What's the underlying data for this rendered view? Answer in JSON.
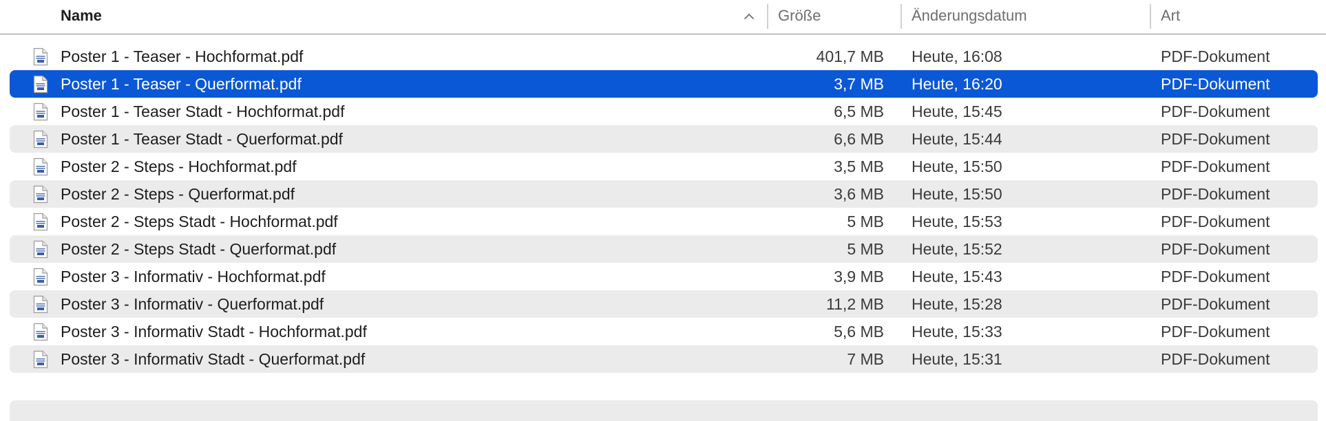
{
  "header": {
    "name": "Name",
    "size": "Größe",
    "date": "Änderungsdatum",
    "kind": "Art",
    "sort_icon": "chevron-up-icon"
  },
  "files": [
    {
      "name": "Poster 1 - Teaser - Hochformat.pdf",
      "size": "401,7 MB",
      "date": "Heute, 16:08",
      "kind": "PDF-Dokument",
      "selected": false
    },
    {
      "name": "Poster 1 - Teaser - Querformat.pdf",
      "size": "3,7 MB",
      "date": "Heute, 16:20",
      "kind": "PDF-Dokument",
      "selected": true
    },
    {
      "name": "Poster 1 - Teaser Stadt - Hochformat.pdf",
      "size": "6,5 MB",
      "date": "Heute, 15:45",
      "kind": "PDF-Dokument",
      "selected": false
    },
    {
      "name": "Poster 1 - Teaser Stadt - Querformat.pdf",
      "size": "6,6 MB",
      "date": "Heute, 15:44",
      "kind": "PDF-Dokument",
      "selected": false
    },
    {
      "name": "Poster 2 - Steps - Hochformat.pdf",
      "size": "3,5 MB",
      "date": "Heute, 15:50",
      "kind": "PDF-Dokument",
      "selected": false
    },
    {
      "name": "Poster 2 - Steps - Querformat.pdf",
      "size": "3,6 MB",
      "date": "Heute, 15:50",
      "kind": "PDF-Dokument",
      "selected": false
    },
    {
      "name": "Poster 2 - Steps Stadt - Hochformat.pdf",
      "size": "5 MB",
      "date": "Heute, 15:53",
      "kind": "PDF-Dokument",
      "selected": false
    },
    {
      "name": "Poster 2 - Steps Stadt - Querformat.pdf",
      "size": "5 MB",
      "date": "Heute, 15:52",
      "kind": "PDF-Dokument",
      "selected": false
    },
    {
      "name": "Poster 3 - Informativ - Hochformat.pdf",
      "size": "3,9 MB",
      "date": "Heute, 15:43",
      "kind": "PDF-Dokument",
      "selected": false
    },
    {
      "name": "Poster 3 - Informativ - Querformat.pdf",
      "size": "11,2 MB",
      "date": "Heute, 15:28",
      "kind": "PDF-Dokument",
      "selected": false
    },
    {
      "name": "Poster 3 - Informativ Stadt - Hochformat.pdf",
      "size": "5,6 MB",
      "date": "Heute, 15:33",
      "kind": "PDF-Dokument",
      "selected": false
    },
    {
      "name": "Poster 3 - Informativ Stadt - Querformat.pdf",
      "size": "7 MB",
      "date": "Heute, 15:31",
      "kind": "PDF-Dokument",
      "selected": false
    }
  ],
  "file_icon": "pdf-document-icon",
  "colors": {
    "selection": "#0a58d6",
    "alt_row": "#ebebeb"
  }
}
